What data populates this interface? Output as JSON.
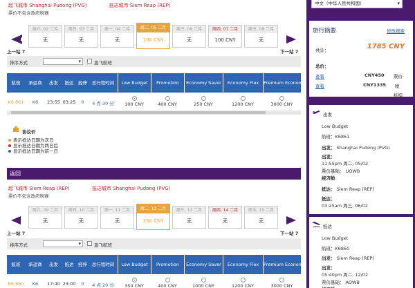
{
  "outbound": {
    "depart_city": "起飞城市 Shanghai Pudong (PVG)",
    "arrive_city": "抵达城市 Siem Reap (REP)",
    "tax_note": "票价不包含政府税赛",
    "prev_label": "上一站 7",
    "next_label": "下一站 7",
    "dates": [
      {
        "head": "周六, 02 二月",
        "price": "无",
        "state": "normal"
      },
      {
        "head": "周日, 03 二月",
        "price": "无",
        "state": "normal"
      },
      {
        "head": "周一, 04 二月",
        "price": "无",
        "state": "normal"
      },
      {
        "head": "周二, 05 二月",
        "price": "100 CNY",
        "state": "selected"
      },
      {
        "head": "周三, 06 二月",
        "price": "无",
        "state": "normal"
      },
      {
        "head": "周四, 07 二月",
        "price": "100 CNY",
        "state": "highlight"
      },
      {
        "head": "周五, 08 二月",
        "price": "无",
        "state": "normal"
      }
    ],
    "sort_label": "排序方式",
    "direct_label": "直飞航班",
    "columns": [
      "航班",
      "承运商",
      "出发",
      "抵达",
      "经停",
      "总行程时间"
    ],
    "fare_columns": [
      "Low Budget",
      "Promotion",
      "Economy Saver",
      "Economy Flex",
      "Premium Econom"
    ],
    "flight": {
      "flight_no": "K6 861",
      "carrier": "K6",
      "depart": "23:55",
      "arrive": "03:25",
      "stops": "0",
      "duration": "4 点 30 分",
      "fares": [
        "100 CNY",
        "400 CNY",
        "250 CNY",
        "1200 CNY",
        "3000 CNY"
      ],
      "selected_fare": 0
    },
    "legend_title": "协议价",
    "legend_items": [
      {
        "text": "表示抵达日期为次日",
        "color": "#e8a33a"
      },
      {
        "text": "显示抵达日期为两日后",
        "color": "#c0272d"
      },
      {
        "text": "显示抵达日期为前一日",
        "color": "#2f66b3"
      }
    ]
  },
  "return_label": "返回",
  "inbound": {
    "depart_city": "起飞城市 Siem Reap (REP)",
    "arrive_city": "抵达城市 Shanghai Pudong (PVG)",
    "tax_note": "票价不包含政府税赛",
    "prev_label": "上一站 7",
    "next_label": "下一站 7",
    "dates": [
      {
        "head": "周六, 09 二月",
        "price": "无",
        "state": "normal"
      },
      {
        "head": "周日, 10 二月",
        "price": "无",
        "state": "normal"
      },
      {
        "head": "周一, 11 二月",
        "price": "无",
        "state": "normal"
      },
      {
        "head": "周二, 12 二月",
        "price": "350 CNY",
        "state": "selected"
      },
      {
        "head": "周三, 13 二月",
        "price": "无",
        "state": "normal"
      },
      {
        "head": "周四, 14 二月",
        "price": "无",
        "state": "highlight"
      },
      {
        "head": "周五, 15 二月",
        "price": "无",
        "state": "normal"
      }
    ],
    "sort_label": "排序方式",
    "direct_label": "直飞航班",
    "columns": [
      "航班",
      "承运商",
      "出发",
      "抵达",
      "经停",
      "总行程时间"
    ],
    "fare_columns": [
      "Low Budget",
      "Promotion",
      "Economy Saver",
      "Economy Flex",
      "Premium Econom"
    ],
    "flight": {
      "flight_no": "K6 860",
      "carrier": "K6",
      "depart": "17:40",
      "arrive": "23:00",
      "stops": "0",
      "duration": "4 点 20 分",
      "fares": [
        "350 CNY",
        "400 CNY",
        "1000 CNY",
        "1200 CNY",
        "3000 CNY"
      ],
      "selected_fare": 0
    }
  },
  "sidebar": {
    "language": "中文（中华人民共和国）",
    "summary_title": "旅行摘要",
    "modify_link": "修改搜索",
    "total_label": "共计：",
    "total_value": "1785 CNY",
    "price_label": "总价：",
    "rows": [
      {
        "link": "查看",
        "value": "CNY450",
        "name": "票价"
      },
      {
        "link": "查看",
        "value": "CNY1335",
        "name": "税"
      }
    ],
    "discount_label": "折扣",
    "depart_section": {
      "title": "出发",
      "fare": "Low Budget",
      "flight_line": "航班：K6861",
      "from_label": "出发：",
      "from_value": "Shanghai Pudong (PVG)",
      "time_label": "出发：",
      "time_value": "11:55pm 周二, 05/02",
      "basis": "票价基础： UOWB",
      "class": "经济舱",
      "to_label": "抵达：",
      "to_value": "Siem Reap (REP)",
      "arr_label": "抵达：",
      "arr_value": "03:25am 周三, 06/02"
    },
    "arrive_section": {
      "title": "抵达",
      "fare": "Low Budget",
      "flight_line": "航班：K6860",
      "from_label": "出发：",
      "from_value": "Siem Reap (REP)",
      "time_label": "出发：",
      "time_value": "05:40pm 周二, 12/02",
      "basis": "票价基础： AOWB",
      "class": "经济舱"
    }
  }
}
